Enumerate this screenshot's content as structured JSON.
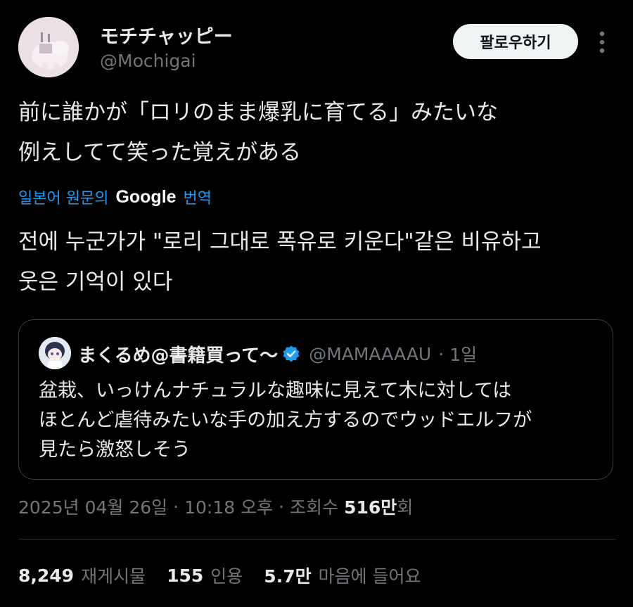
{
  "author": {
    "display_name": "モチチャッピー",
    "handle": "@Mochigai"
  },
  "header": {
    "follow_label": "팔로우하기"
  },
  "tweet": {
    "text": "前に誰かが「ロリのまま爆乳に育てる」みたいな\n例えしてて笑った覚えがある",
    "translate_label": "일본어 원문의",
    "translate_brand": "Google",
    "translate_action": "번역",
    "translated_text": "전에 누군가가 \"로리 그대로 폭유로 키운다\"같은 비유하고\n웃은 기억이 있다"
  },
  "quote": {
    "name": "まくるめ@書籍買って〜",
    "handle": "@MAMAAAAU",
    "separator": "·",
    "time": "1일",
    "text": "盆栽、いっけんナチュラルな趣味に見えて木に対しては\nほとんど虐待みたいな手の加え方するのでウッドエルフが\n見たら激怒しそう"
  },
  "meta": {
    "timestamp": "2025년 04월 26일",
    "separator": "·",
    "time": "10:18 오후",
    "views_label": "조회수",
    "views_number": "516만",
    "views_suffix": "회"
  },
  "stats": {
    "retweets_count": "8,249",
    "retweets_label": "재게시물",
    "quotes_count": "155",
    "quotes_label": "인용",
    "likes_count": "5.7만",
    "likes_label": "마음에 들어요"
  },
  "colors": {
    "background": "#000000",
    "text": "#e7e9ea",
    "muted": "#71767b",
    "link": "#1d9bf0",
    "verified": "#1d9bf0",
    "button_bg": "#eff3f4"
  },
  "icons": {
    "more": "more-vertical-icon",
    "verified": "verified-badge-icon"
  }
}
